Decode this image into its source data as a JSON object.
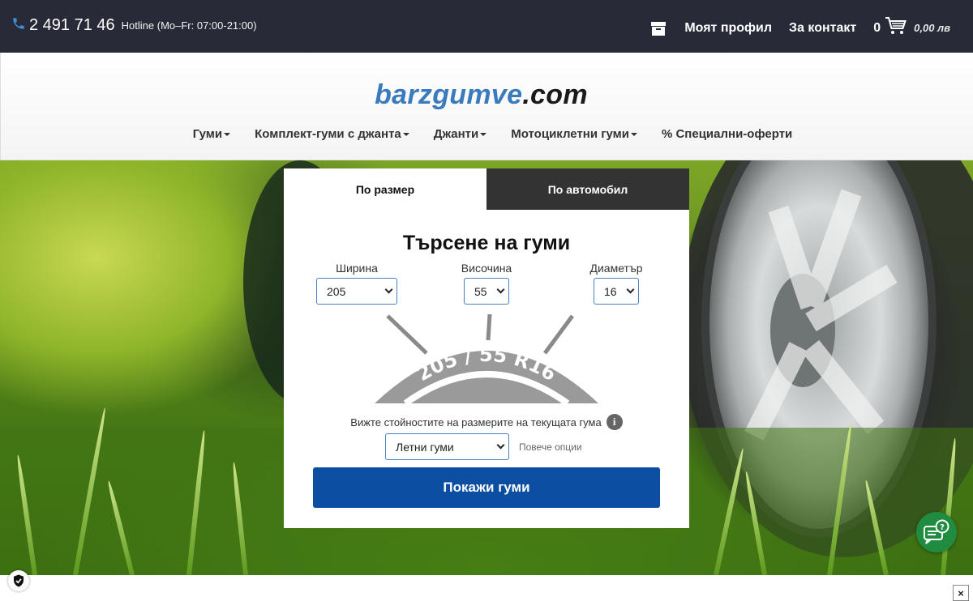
{
  "topbar": {
    "phone_icon": "phone-icon",
    "phone_number": "2 491 71 46",
    "hotline": "Hotline (Mo–Fr: 07:00-21:00)",
    "archive_icon": "archive-icon",
    "profile_label": "Моят профил",
    "contact_label": "За контакт",
    "cart_count": "0",
    "cart_icon": "cart-icon",
    "cart_total": "0,00 лв"
  },
  "header": {
    "logo_part1": "barzgumve",
    "logo_part2": ".com",
    "nav": [
      {
        "label": "Гуми",
        "dropdown": true
      },
      {
        "label": "Комплект-гуми с джанта",
        "dropdown": true
      },
      {
        "label": "Джанти",
        "dropdown": true
      },
      {
        "label": "Мотоциклетни гуми",
        "dropdown": true
      },
      {
        "label": "% Специални-оферти",
        "dropdown": false
      }
    ]
  },
  "search": {
    "tabs": {
      "by_size": "По размер",
      "by_vehicle": "По автомобил"
    },
    "title": "Търсене на гуми",
    "width": {
      "label": "Ширина",
      "value": "205"
    },
    "height": {
      "label": "Височина",
      "value": "55"
    },
    "diameter": {
      "label": "Диаметър",
      "value": "16"
    },
    "tire_label": "205 / 55 R16",
    "hint": "Вижте стойностите на размерите на текущата гума",
    "info_icon": "info-icon",
    "season_value": "Летни гуми",
    "more_options": "Повече опции",
    "submit_label": "Покажи гуми"
  },
  "widgets": {
    "chat_icon": "chat-help-icon",
    "shield_icon": "shield-check-icon",
    "close_label": "×"
  },
  "colors": {
    "topbar_bg": "#282a38",
    "brand_blue": "#3a7bbd",
    "button_blue": "#0b4ea2",
    "chat_green": "#1f8c3f"
  }
}
